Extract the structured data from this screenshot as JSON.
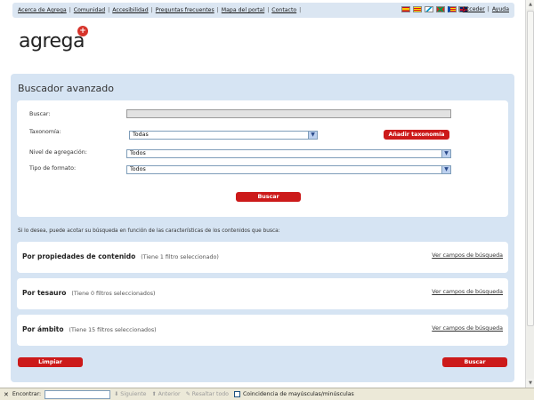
{
  "topnav": {
    "links": [
      "Acerca de Agrega",
      "Comunidad",
      "Accesibilidad",
      "Preguntas frecuentes",
      "Mapa del portal",
      "Contacto"
    ],
    "flags": [
      {
        "lang": "es",
        "colors": [
          "#c60b1e",
          "#ffc400",
          "#c60b1e"
        ]
      },
      {
        "lang": "ca",
        "colors": [
          "#fcdd09",
          "#da121a",
          "#fcdd09"
        ]
      },
      {
        "lang": "gl",
        "colors": [
          "#ffffff",
          "#0099cc",
          "#ffffff"
        ]
      },
      {
        "lang": "eu",
        "colors": [
          "#d52b1e",
          "#009b48",
          "#ffffff"
        ]
      },
      {
        "lang": "va",
        "colors": [
          "#da121a",
          "#fcdd09",
          "#da121a"
        ]
      },
      {
        "lang": "en",
        "colors": [
          "#012169",
          "#c8102e",
          "#ffffff"
        ]
      }
    ],
    "access": "Acceder",
    "help": "Ayuda"
  },
  "logo": {
    "text": "agrega",
    "mark": "+"
  },
  "panel": {
    "title": "Buscador avanzado",
    "buscar_label": "Buscar:",
    "buscar_value": "",
    "taxonomia_label": "Taxonomía:",
    "taxonomia_value": "Todas",
    "add_taxonomy": "Añadir taxonomía",
    "nivel_label": "Nivel de agregación:",
    "nivel_value": "Todos",
    "formato_label": "Tipo de formato:",
    "formato_value": "Todos",
    "search_button": "Buscar",
    "hint": "Si lo desea, puede acotar su búsqueda en función de las características de los contenidos que busca:",
    "rows": [
      {
        "title": "Por propiedades de contenido",
        "info": "(Tiene 1  filtro seleccionado)",
        "link": "Ver campos de búsqueda"
      },
      {
        "title": "Por tesauro",
        "info": "(Tiene 0 filtros seleccionados)",
        "link": "Ver campos de búsqueda"
      },
      {
        "title": "Por ámbito",
        "info": "(Tiene  15  filtros seleccionados)",
        "link": "Ver campos de búsqueda"
      }
    ],
    "clear_button": "Limpiar",
    "bottom_search": "Buscar"
  },
  "findbar": {
    "close": "✕",
    "label": "Encontrar:",
    "value": "",
    "next": "Siguiente",
    "prev": "Anterior",
    "highlight": "Resaltar todo",
    "match_case": "Coincidencia de mayúsculas/minúsculas"
  },
  "colors": {
    "accent_red": "#cc1a1a",
    "panel_bg": "#d6e4f3",
    "topbar_bg": "#dbe6f2"
  }
}
